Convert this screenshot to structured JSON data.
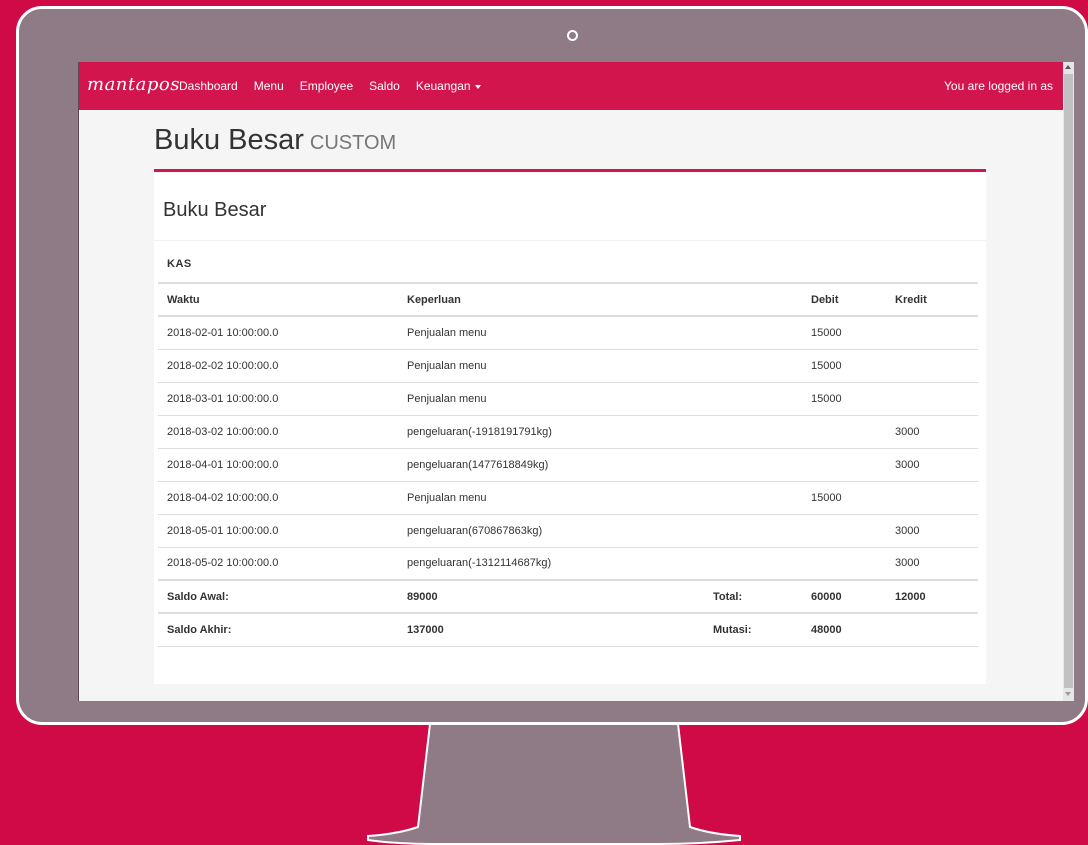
{
  "navbar": {
    "brand": "mantapos",
    "links": [
      "Dashboard",
      "Menu",
      "Employee",
      "Saldo",
      "Keuangan"
    ],
    "user_status": "You are logged in as"
  },
  "header": {
    "title": "Buku Besar",
    "subtitle": "CUSTOM"
  },
  "panel": {
    "title": "Buku Besar",
    "section": "KAS"
  },
  "table": {
    "columns": {
      "waktu": "Waktu",
      "keperluan": "Keperluan",
      "debit": "Debit",
      "kredit": "Kredit"
    },
    "rows": [
      {
        "waktu": "2018-02-01 10:00:00.0",
        "keperluan": "Penjualan menu",
        "debit": "15000",
        "kredit": ""
      },
      {
        "waktu": "2018-02-02 10:00:00.0",
        "keperluan": "Penjualan menu",
        "debit": "15000",
        "kredit": ""
      },
      {
        "waktu": "2018-03-01 10:00:00.0",
        "keperluan": "Penjualan menu",
        "debit": "15000",
        "kredit": ""
      },
      {
        "waktu": "2018-03-02 10:00:00.0",
        "keperluan": "pengeluaran(-1918191791kg)",
        "debit": "",
        "kredit": "3000"
      },
      {
        "waktu": "2018-04-01 10:00:00.0",
        "keperluan": "pengeluaran(1477618849kg)",
        "debit": "",
        "kredit": "3000"
      },
      {
        "waktu": "2018-04-02 10:00:00.0",
        "keperluan": "Penjualan menu",
        "debit": "15000",
        "kredit": ""
      },
      {
        "waktu": "2018-05-01 10:00:00.0",
        "keperluan": "pengeluaran(670867863kg)",
        "debit": "",
        "kredit": "3000"
      },
      {
        "waktu": "2018-05-02 10:00:00.0",
        "keperluan": "pengeluaran(-1312114687kg)",
        "debit": "",
        "kredit": "3000"
      }
    ],
    "summary": {
      "saldo_awal_label": "Saldo Awal:",
      "saldo_awal_value": "89000",
      "total_label": "Total:",
      "total_debit": "60000",
      "total_kredit": "12000",
      "saldo_akhir_label": "Saldo Akhir:",
      "saldo_akhir_value": "137000",
      "mutasi_label": "Mutasi:",
      "mutasi_value": "48000"
    }
  },
  "colors": {
    "brand": "#d2164d",
    "background": "#cf0a47",
    "monitor_frame": "#8e7b86",
    "page_bg": "#f5f5f5"
  }
}
